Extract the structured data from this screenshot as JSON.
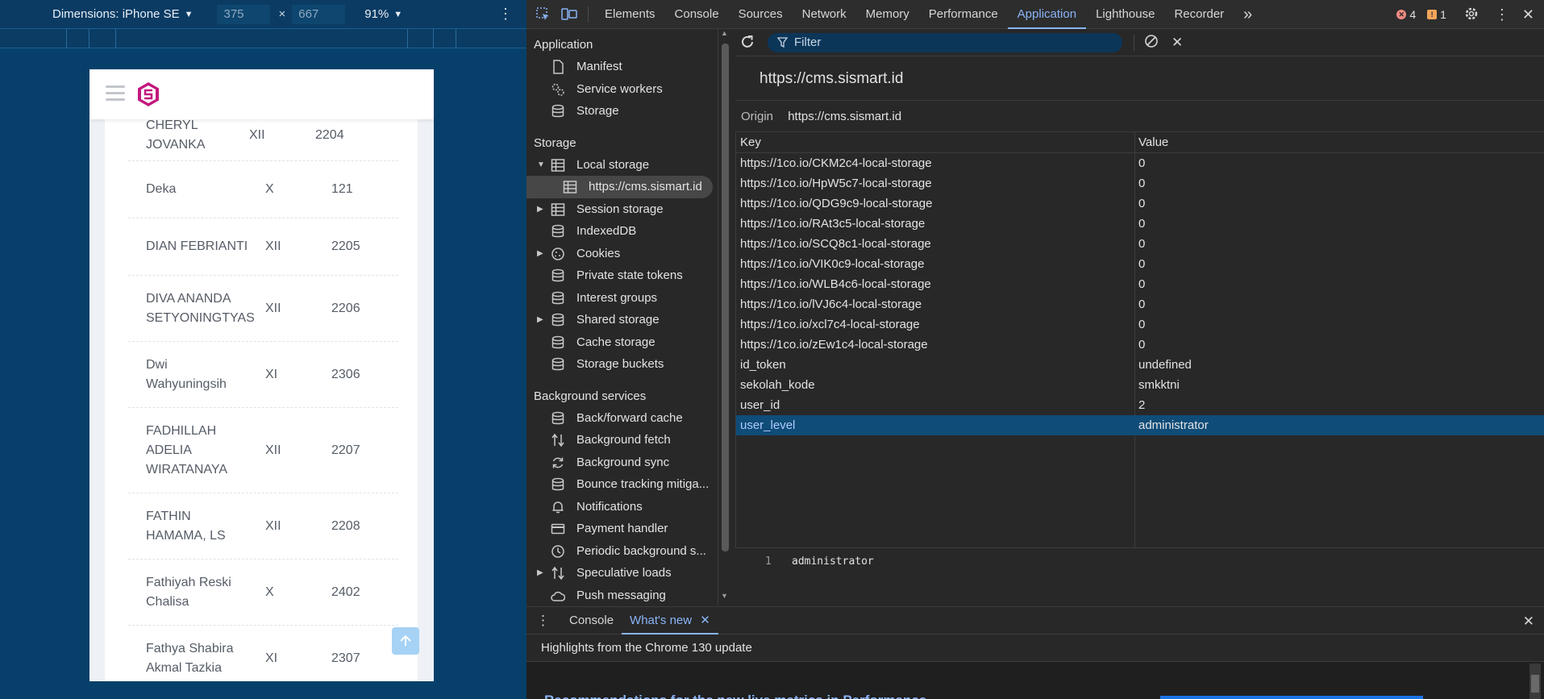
{
  "device_toolbar": {
    "dimensions_label": "Dimensions: iPhone SE",
    "width": "375",
    "height": "667",
    "times": "×",
    "zoom": "91%"
  },
  "phone": {
    "students": [
      {
        "name": "CHERYL JOVANKA",
        "class": "XII",
        "id": "2204"
      },
      {
        "name": "Deka",
        "class": "X",
        "id": "121"
      },
      {
        "name": "DIAN FEBRIANTI",
        "class": "XII",
        "id": "2205"
      },
      {
        "name": "DIVA ANANDA SETYONINGTYAS",
        "class": "XII",
        "id": "2206"
      },
      {
        "name": "Dwi Wahyuningsih",
        "class": "XI",
        "id": "2306"
      },
      {
        "name": "FADHILLAH ADELIA WIRATANAYA",
        "class": "XII",
        "id": "2207"
      },
      {
        "name": "FATHIN HAMAMA, LS",
        "class": "XII",
        "id": "2208"
      },
      {
        "name": "Fathiyah Reski Chalisa",
        "class": "X",
        "id": "2402"
      },
      {
        "name": "Fathya Shabira Akmal Tazkia",
        "class": "XI",
        "id": "2307"
      }
    ]
  },
  "devtools": {
    "tabs": [
      "Elements",
      "Console",
      "Sources",
      "Network",
      "Memory",
      "Performance",
      "Application",
      "Lighthouse",
      "Recorder"
    ],
    "more_tabs": "»",
    "errors": "4",
    "warnings": "1",
    "sidebar": {
      "application_title": "Application",
      "application_items": [
        "Manifest",
        "Service workers",
        "Storage"
      ],
      "storage_title": "Storage",
      "local_storage": "Local storage",
      "local_storage_origin": "https://cms.sismart.id",
      "storage_items": [
        "Session storage",
        "IndexedDB",
        "Cookies",
        "Private state tokens",
        "Interest groups",
        "Shared storage",
        "Cache storage",
        "Storage buckets"
      ],
      "background_title": "Background services",
      "background_items": [
        "Back/forward cache",
        "Background fetch",
        "Background sync",
        "Bounce tracking mitiga...",
        "Notifications",
        "Payment handler",
        "Periodic background s...",
        "Speculative loads",
        "Push messaging"
      ]
    },
    "storage": {
      "filter_placeholder": "Filter",
      "origin_title": "https://cms.sismart.id",
      "origin_label": "Origin",
      "origin_value": "https://cms.sismart.id",
      "col_key": "Key",
      "col_value": "Value",
      "rows": [
        {
          "key": "https://1co.io/CKM2c4-local-storage",
          "value": "0"
        },
        {
          "key": "https://1co.io/HpW5c7-local-storage",
          "value": "0"
        },
        {
          "key": "https://1co.io/QDG9c9-local-storage",
          "value": "0"
        },
        {
          "key": "https://1co.io/RAt3c5-local-storage",
          "value": "0"
        },
        {
          "key": "https://1co.io/SCQ8c1-local-storage",
          "value": "0"
        },
        {
          "key": "https://1co.io/VIK0c9-local-storage",
          "value": "0"
        },
        {
          "key": "https://1co.io/WLB4c6-local-storage",
          "value": "0"
        },
        {
          "key": "https://1co.io/lVJ6c4-local-storage",
          "value": "0"
        },
        {
          "key": "https://1co.io/xcl7c4-local-storage",
          "value": "0"
        },
        {
          "key": "https://1co.io/zEw1c4-local-storage",
          "value": "0"
        },
        {
          "key": "id_token",
          "value": "undefined"
        },
        {
          "key": "sekolah_kode",
          "value": "smkktni"
        },
        {
          "key": "user_id",
          "value": "2"
        },
        {
          "key": "user_level",
          "value": "administrator"
        }
      ],
      "preview_line": "1",
      "preview_value": "administrator"
    },
    "drawer": {
      "tabs": [
        "Console",
        "What's new"
      ],
      "highlight": "Highlights from the Chrome 130 update",
      "teaser": "Recommendations for the new live metrics in Performance"
    }
  }
}
